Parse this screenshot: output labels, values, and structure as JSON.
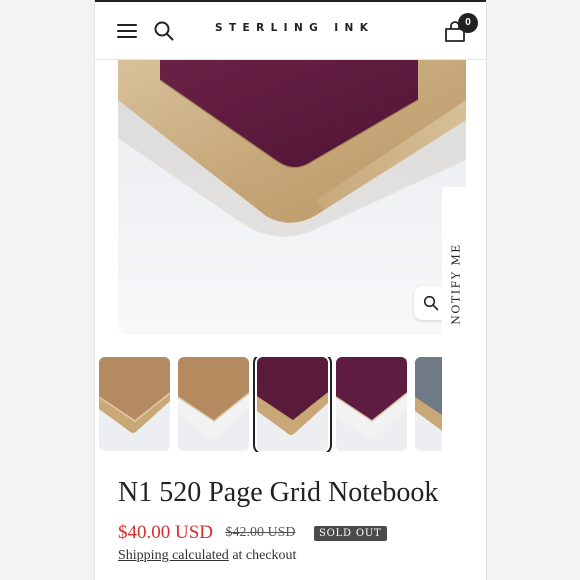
{
  "header": {
    "logo": "STERLING INK",
    "cart_count": "0",
    "icons": {
      "menu": "hamburger-menu-icon",
      "search": "search-icon",
      "cart": "shopping-bag-icon"
    }
  },
  "gallery": {
    "hero_image": "Burgundy notebook with gold-edged corner",
    "zoom_icon": "magnifier-icon",
    "selected_index": 2,
    "thumbnails": [
      {
        "cover_color": "#b48a62",
        "page_color": "#d9b98d"
      },
      {
        "cover_color": "#b58a5f",
        "page_color": "#f2f2f2"
      },
      {
        "cover_color": "#5a1a3c",
        "page_color": "#d9b98d"
      },
      {
        "cover_color": "#5e1c40",
        "page_color": "#f2f2f2"
      },
      {
        "cover_color": "#6f7a86",
        "page_color": "#d9b98d"
      }
    ]
  },
  "notify": {
    "label": "NOTIFY ME"
  },
  "product": {
    "title": "N1 520 Page Grid Notebook",
    "price": "$40.00 USD",
    "compare_price": "$42.00 USD",
    "badge": "SOLD OUT",
    "shipping_link": "Shipping calculated",
    "shipping_suffix": " at checkout"
  },
  "colors": {
    "price": "#d32f2f",
    "badge_bg": "#4b4b4b",
    "cover_burgundy": "#5a1a3c",
    "gold_edge": "#c9a877"
  }
}
